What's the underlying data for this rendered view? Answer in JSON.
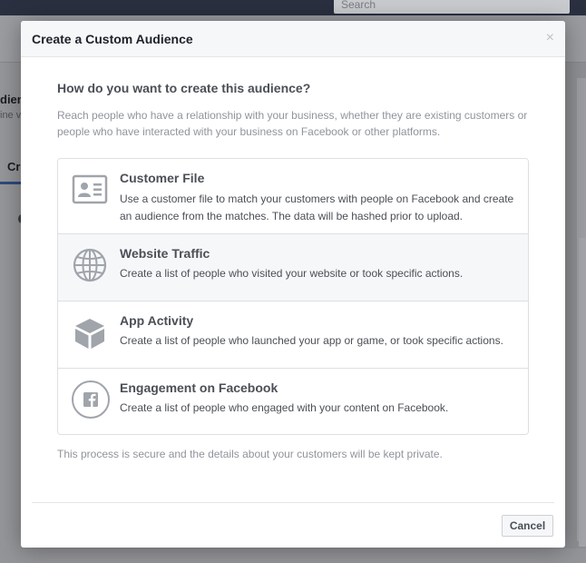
{
  "background": {
    "search_placeholder": "Search",
    "left_title": "dien",
    "left_subtitle": "ine v",
    "left_tab": "Cr"
  },
  "dialog": {
    "title": "Create a Custom Audience",
    "close_glyph": "×",
    "question": "How do you want to create this audience?",
    "description": "Reach people who have a relationship with your business, whether they are existing customers or people who have interacted with your business on Facebook or other platforms.",
    "options": [
      {
        "title": "Customer File",
        "description": "Use a customer file to match your customers with people on Facebook and create an audience from the matches. The data will be hashed prior to upload.",
        "icon": "contact-card-icon"
      },
      {
        "title": "Website Traffic",
        "description": "Create a list of people who visited your website or took specific actions.",
        "icon": "globe-icon"
      },
      {
        "title": "App Activity",
        "description": "Create a list of people who launched your app or game, or took specific actions.",
        "icon": "cube-icon"
      },
      {
        "title": "Engagement on Facebook",
        "description": "Create a list of people who engaged with your content on Facebook.",
        "icon": "facebook-icon"
      }
    ],
    "privacy_note": "This process is secure and the details about your customers will be kept private.",
    "cancel_label": "Cancel"
  },
  "colors": {
    "icon_gray": "#a0a4ab",
    "hover_row": "#f6f7f9",
    "title_text": "#4b4f56",
    "muted_text": "#90949c"
  }
}
